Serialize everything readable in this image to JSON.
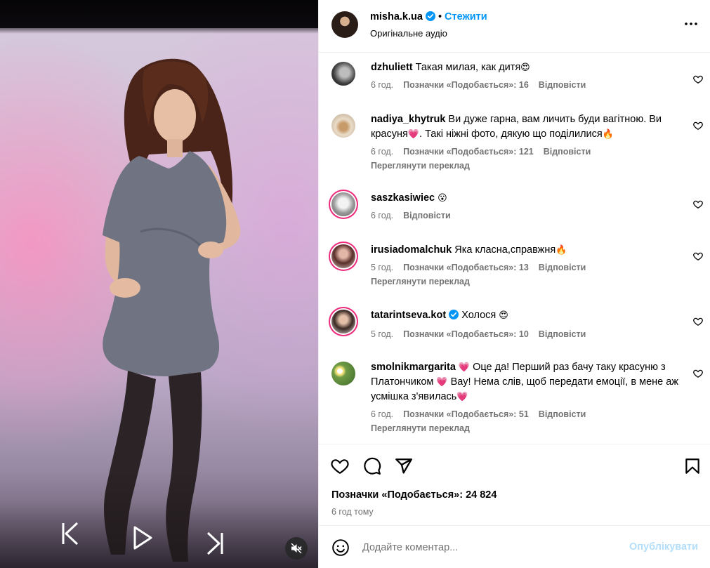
{
  "post": {
    "author": "misha.k.ua",
    "follow_label": "Стежити",
    "separator": "•",
    "audio_label": "Оригінальне аудіо"
  },
  "comments": [
    {
      "user": "dzhuliett",
      "text": "Такая милая, как дитя",
      "emoji": "😍",
      "time": "6 год.",
      "likes": "Позначки «Подобається»: 16",
      "reply": "Відповісти"
    },
    {
      "user": "nadiya_khytruk",
      "text_a": "Ви дуже гарна, вам личить буди вагітною. Ви красуня",
      "emoji_a": "💗",
      "text_b": ". Такі ніжні фото, дякую що поділилися",
      "emoji_b": "🔥",
      "time": "6 год.",
      "likes": "Позначки «Подобається»: 121",
      "reply": "Відповісти",
      "translate": "Переглянути переклад"
    },
    {
      "user": "saszkasiwiec",
      "emoji": "😮",
      "time": "6 год.",
      "reply": "Відповісти"
    },
    {
      "user": "irusiadomalchuk",
      "text": "Яка класна,справжня",
      "emoji": "🔥",
      "time": "5 год.",
      "likes": "Позначки «Подобається»: 13",
      "reply": "Відповісти",
      "translate": "Переглянути переклад"
    },
    {
      "user": "tatarintseva.kot",
      "text": "Холося",
      "emoji": "😍",
      "time": "5 год.",
      "likes": "Позначки «Подобається»: 10",
      "reply": "Відповісти"
    },
    {
      "user": "smolnikmargarita",
      "emoji_a": "💗",
      "text_a": "Оце да! Перший раз бачу таку красуню з Платончиком",
      "emoji_b": "💗",
      "text_b": " Вау! Нема слів, щоб передати емоції, в мене аж усмішка з'явилась",
      "emoji_c": "💗",
      "time": "6 год.",
      "likes": "Позначки «Подобається»: 51",
      "reply": "Відповісти",
      "translate": "Переглянути переклад"
    }
  ],
  "stats": {
    "likes": "Позначки «Подобається»: 24 824",
    "time_ago": "6 год тому"
  },
  "composer": {
    "placeholder": "Додайте коментар...",
    "publish_label": "Опублікувати"
  },
  "icons": {
    "verified": "verified-badge-icon",
    "more": "more-options-icon",
    "like": "heart-icon",
    "comment": "comment-icon",
    "share": "share-icon",
    "save": "bookmark-icon",
    "emoji": "emoji-icon",
    "mute": "mute-icon",
    "prev": "skip-previous-icon",
    "play": "play-icon",
    "next": "skip-next-icon"
  },
  "colors": {
    "link": "#0095f6",
    "verified": "#0095f6",
    "publish_disabled": "#b2dffc",
    "meta_text": "#737373",
    "story_ring": "#ee2a7b"
  }
}
